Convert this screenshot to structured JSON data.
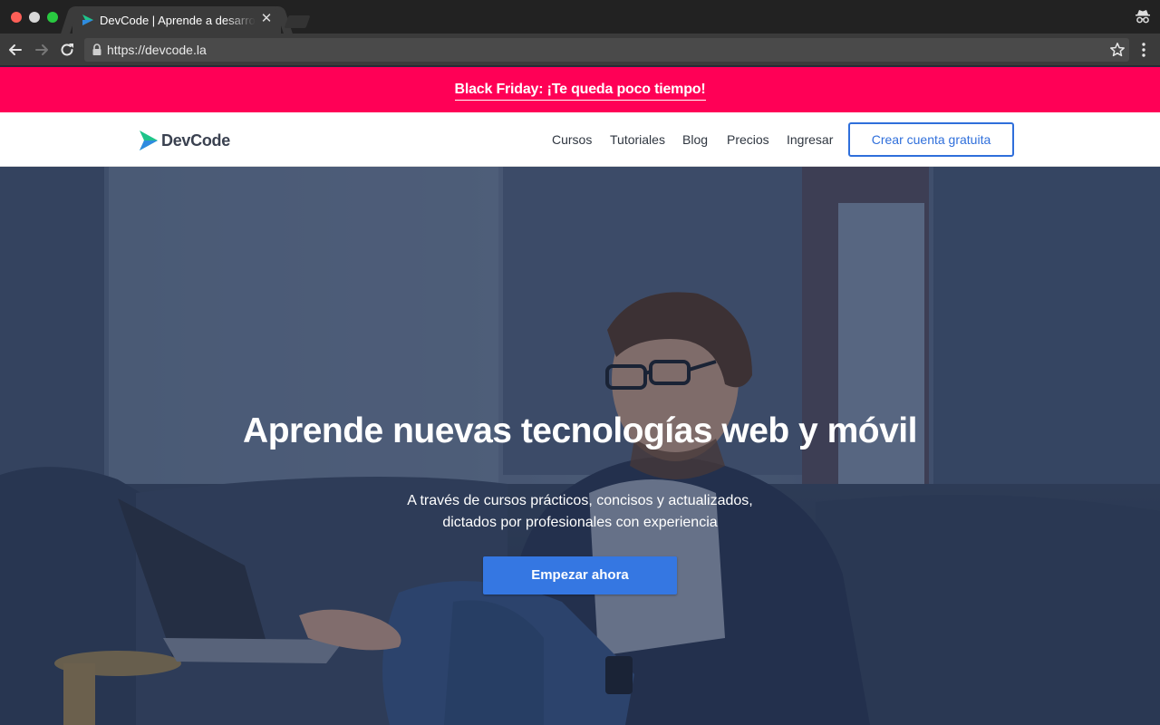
{
  "browser": {
    "tab_title": "DevCode | Aprende a desarrollar",
    "tab_close": "✕",
    "url": "https://devcode.la"
  },
  "promo": {
    "text": "Black Friday: ¡Te queda poco tiempo!",
    "color": "#ff0056"
  },
  "header": {
    "logo_text": "DevCode",
    "nav": [
      "Cursos",
      "Tutoriales",
      "Blog",
      "Precios",
      "Ingresar"
    ],
    "cta": "Crear cuenta gratuita",
    "accent": "#2f6fdb"
  },
  "hero": {
    "title": "Aprende nuevas tecnologías web y móvil",
    "subtitle_line1": "A través de cursos prácticos, concisos y actualizados,",
    "subtitle_line2": "dictados por profesionales con experiencia",
    "button": "Empezar ahora",
    "button_color": "#3577e2"
  },
  "icons": {
    "back": "arrow-left-icon",
    "forward": "arrow-right-icon",
    "reload": "reload-icon",
    "lock": "lock-icon",
    "bookmark": "star-icon",
    "menu": "more-vertical-icon",
    "incognito": "incognito-icon"
  }
}
